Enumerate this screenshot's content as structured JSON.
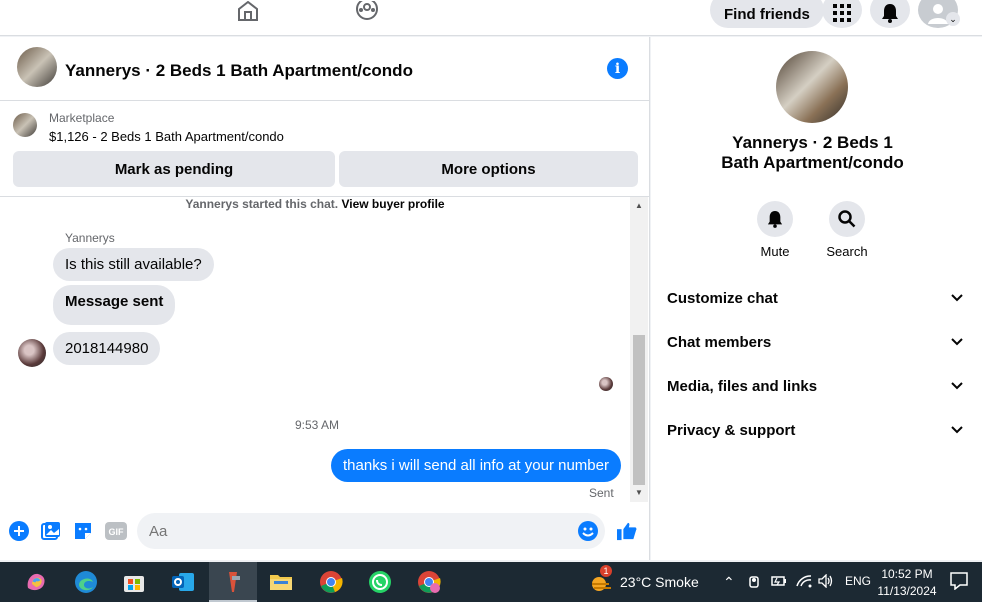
{
  "topnav": {
    "find_friends": "Find friends",
    "icons": [
      "home-icon",
      "groups-icon",
      "menu-grid-icon",
      "bell-icon",
      "account-icon"
    ]
  },
  "chat": {
    "title": "Yannerys · 2 Beds 1 Bath Apartment/condo",
    "listing": {
      "source": "Marketplace",
      "description": "$1,126 - 2 Beds 1 Bath Apartment/condo"
    },
    "buttons": {
      "mark_pending": "Mark as pending",
      "more_options": "More options"
    },
    "system_message": {
      "text": "Yannerys started this chat.",
      "link": "View buyer profile"
    },
    "sender_name": "Yannerys",
    "incoming": [
      "Is this still available?",
      "Message sent",
      "2018144980"
    ],
    "timestamp": "9:53 AM",
    "outgoing": "thanks i will send all info at your number",
    "status": "Sent",
    "input_placeholder": "Aa",
    "composer_icons": [
      "plus-icon",
      "image-icon",
      "sticker-icon",
      "gif-icon",
      "emoji-icon",
      "like-icon"
    ]
  },
  "info_panel": {
    "title": "Yannerys · 2 Beds 1 Bath Apartment/condo",
    "actions": [
      {
        "label": "Mute",
        "icon": "bell-icon"
      },
      {
        "label": "Search",
        "icon": "search-icon"
      }
    ],
    "sections": [
      "Customize chat",
      "Chat members",
      "Media, files and links",
      "Privacy & support"
    ]
  },
  "taskbar": {
    "weather": "23°C  Smoke",
    "weather_badge": "1",
    "language": "ENG",
    "time": "10:52 PM",
    "date": "11/13/2024"
  },
  "colors": {
    "accent": "#0a7cff",
    "bubble_grey": "#e4e6eb",
    "taskbar": "#1c2933"
  }
}
